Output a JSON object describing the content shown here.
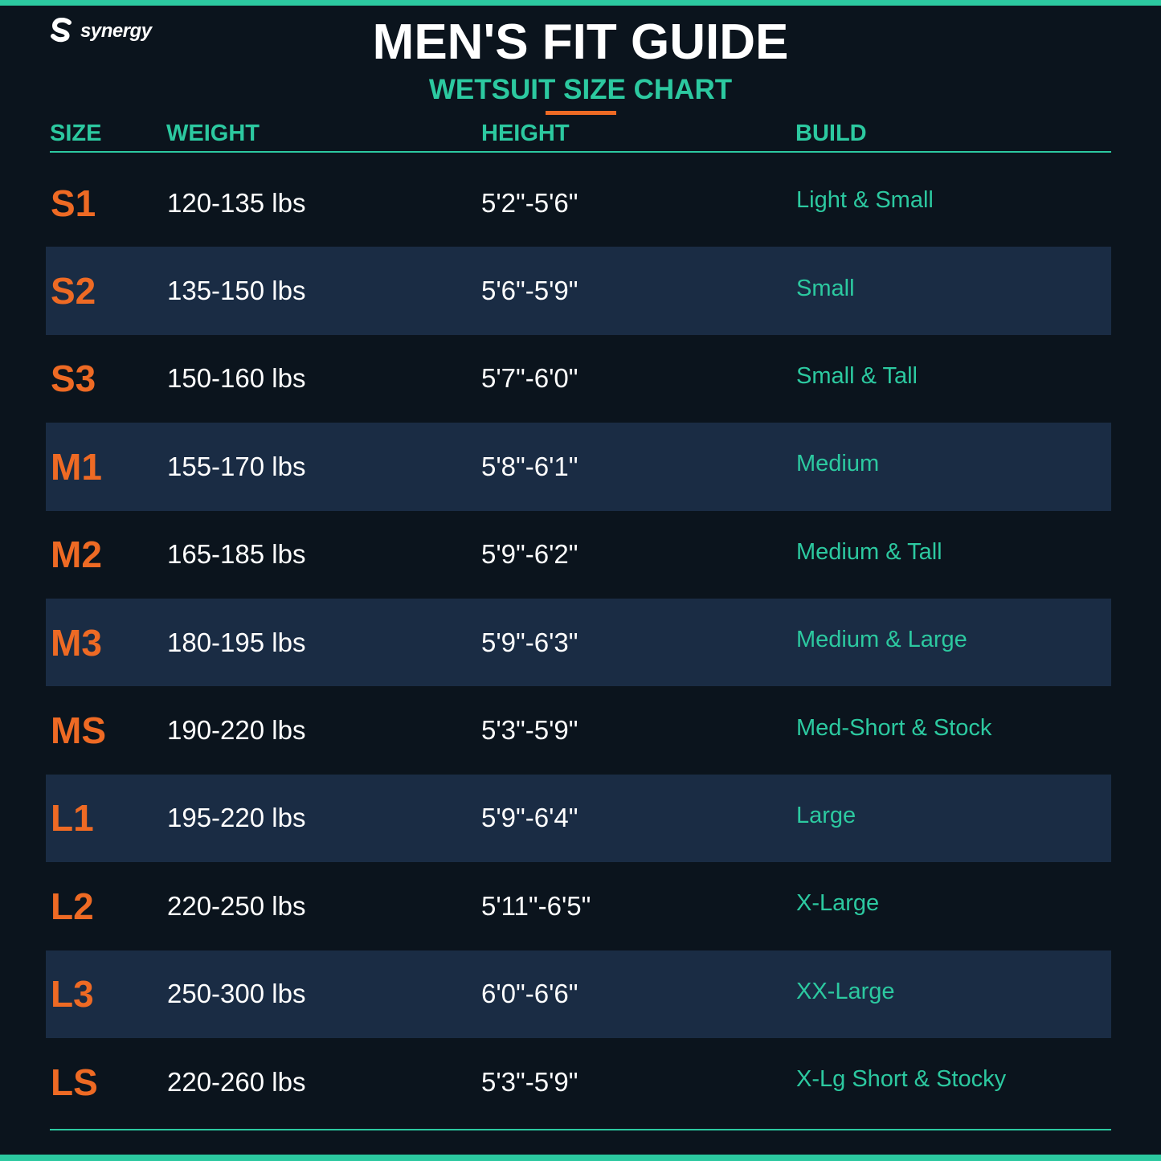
{
  "brand": {
    "name": "synergy",
    "logo_icon": "synergy-s-logo-icon"
  },
  "title": "MEN'S FIT GUIDE",
  "subtitle": "WETSUIT SIZE CHART",
  "colors": {
    "background": "#0b141d",
    "row_alt": "#1a2c44",
    "accent_teal": "#2cc9a0",
    "accent_orange": "#ee6a24",
    "text": "#ffffff"
  },
  "table": {
    "headers": [
      "SIZE",
      "WEIGHT",
      "HEIGHT",
      "BUILD"
    ],
    "rows": [
      {
        "size": "S1",
        "weight": "120-135 lbs",
        "height": "5'2\"-5'6\"",
        "build": "Light & Small"
      },
      {
        "size": "S2",
        "weight": "135-150 lbs",
        "height": "5'6\"-5'9\"",
        "build": "Small"
      },
      {
        "size": "S3",
        "weight": "150-160 lbs",
        "height": "5'7\"-6'0\"",
        "build": "Small & Tall"
      },
      {
        "size": "M1",
        "weight": "155-170 lbs",
        "height": "5'8\"-6'1\"",
        "build": "Medium"
      },
      {
        "size": "M2",
        "weight": "165-185 lbs",
        "height": "5'9\"-6'2\"",
        "build": "Medium & Tall"
      },
      {
        "size": "M3",
        "weight": "180-195 lbs",
        "height": "5'9\"-6'3\"",
        "build": "Medium & Large"
      },
      {
        "size": "MS",
        "weight": "190-220 lbs",
        "height": "5'3\"-5'9\"",
        "build": "Med-Short & Stock"
      },
      {
        "size": "L1",
        "weight": "195-220 lbs",
        "height": "5'9\"-6'4\"",
        "build": "Large"
      },
      {
        "size": "L2",
        "weight": "220-250 lbs",
        "height": "5'11\"-6'5\"",
        "build": "X-Large"
      },
      {
        "size": "L3",
        "weight": "250-300 lbs",
        "height": "6'0\"-6'6\"",
        "build": "XX-Large"
      },
      {
        "size": "LS",
        "weight": "220-260 lbs",
        "height": "5'3\"-5'9\"",
        "build": "X-Lg Short & Stocky"
      }
    ]
  }
}
